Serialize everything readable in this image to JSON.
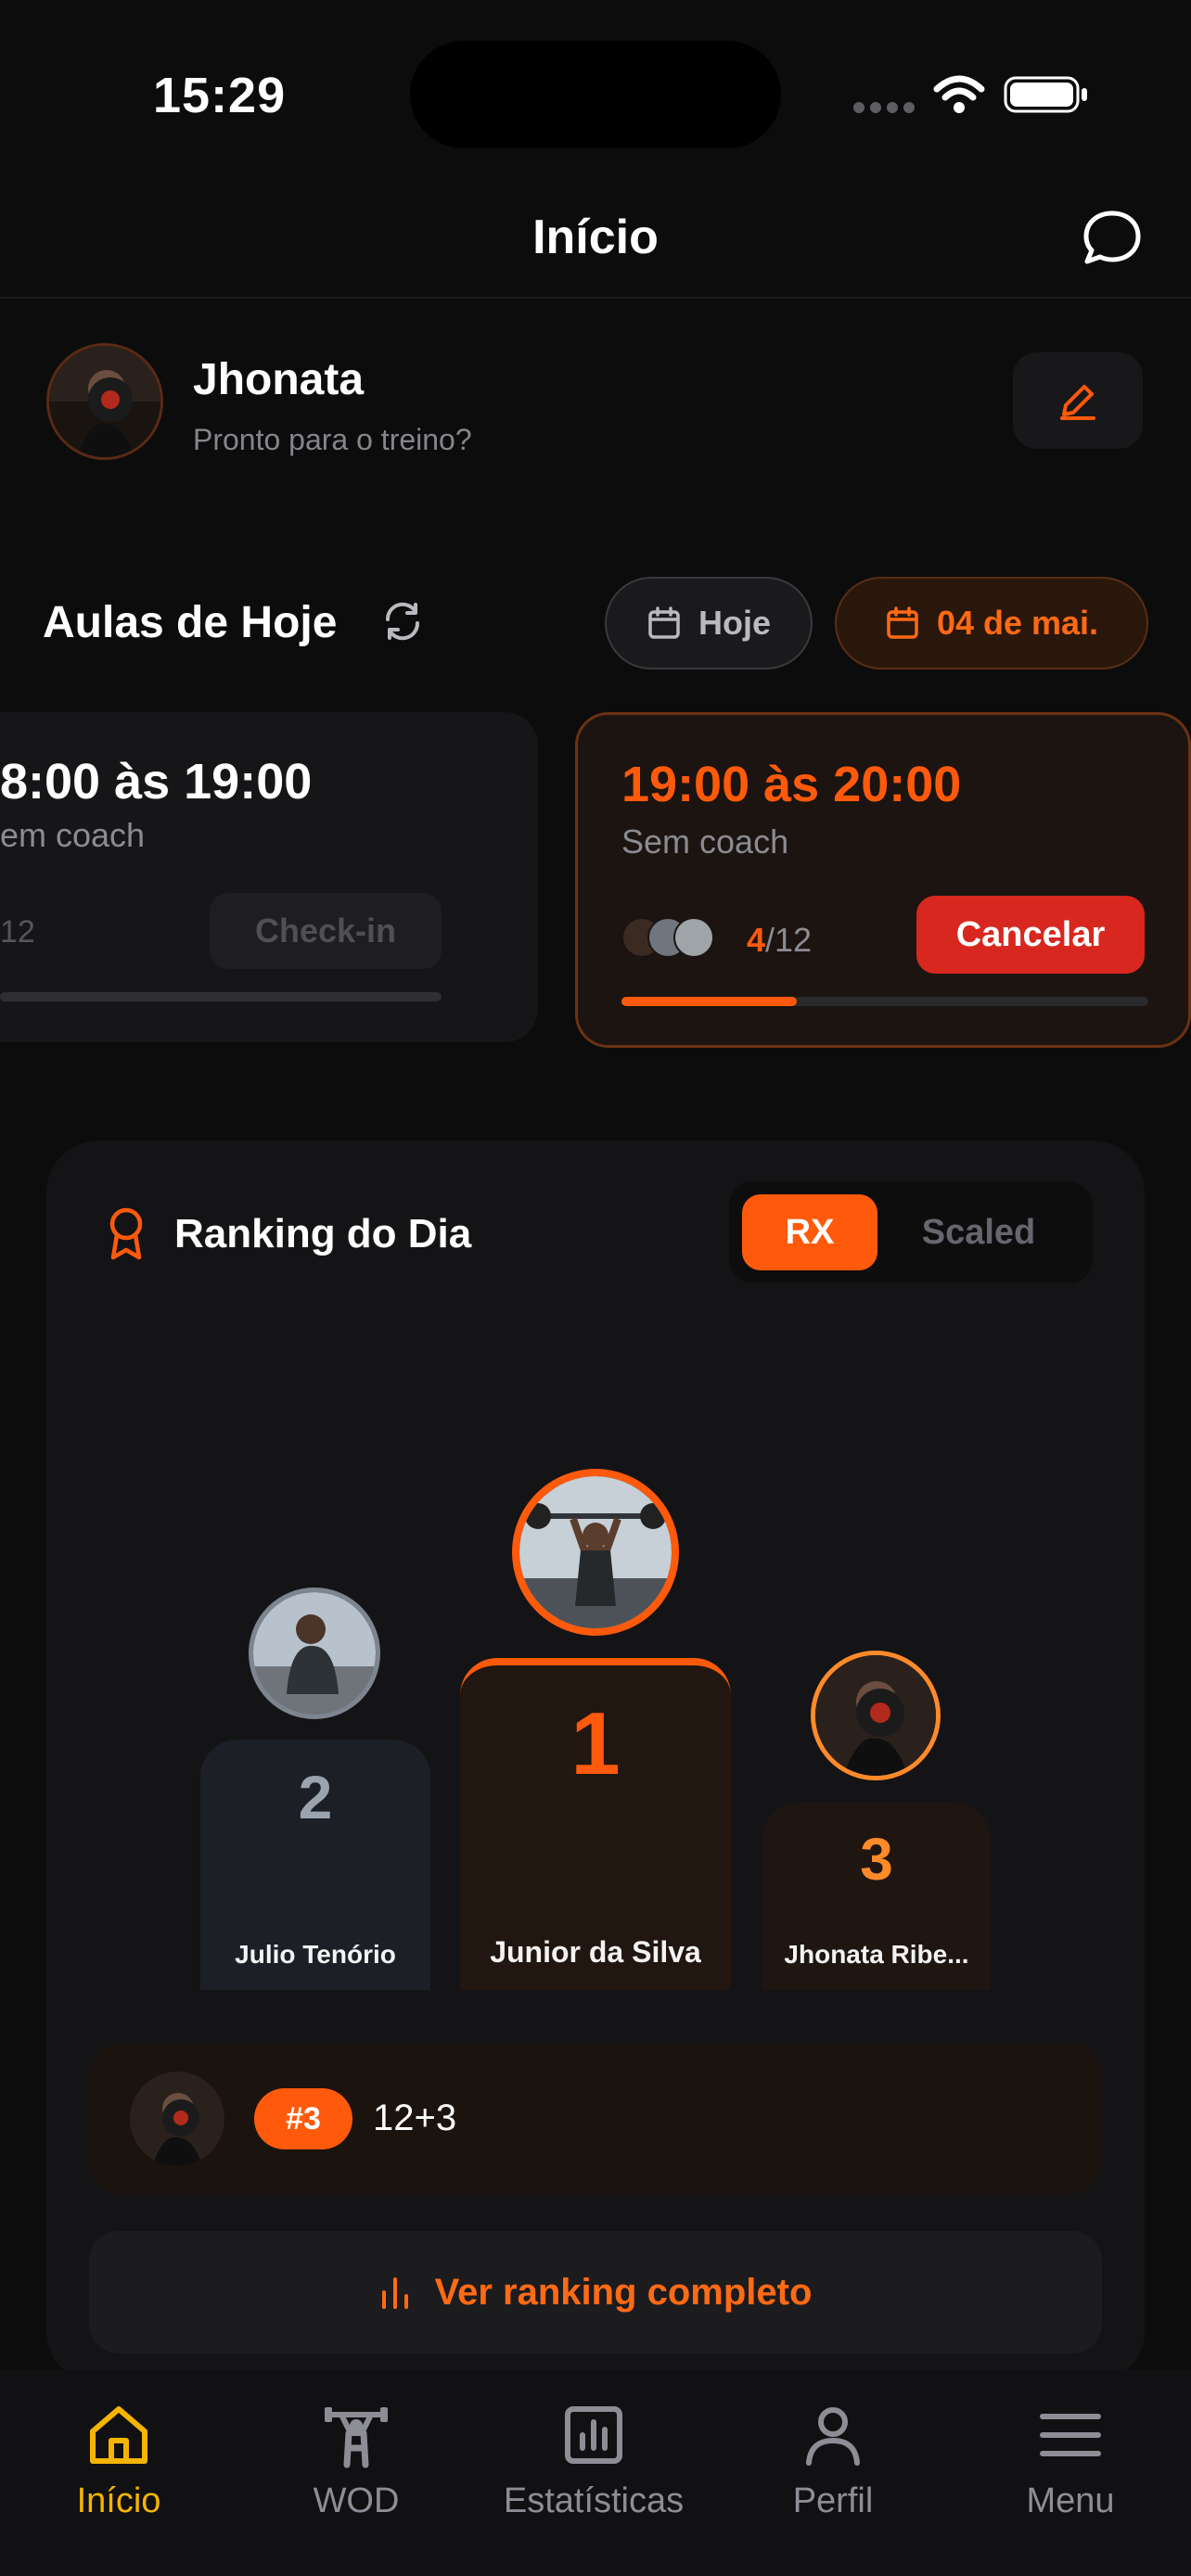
{
  "status_bar": {
    "time": "15:29"
  },
  "header": {
    "title": "Início"
  },
  "profile": {
    "name": "Jhonata",
    "subtitle": "Pronto para o treino?"
  },
  "today": {
    "title": "Aulas de Hoje",
    "chip_today": "Hoje",
    "chip_date": "04 de mai.",
    "classes": [
      {
        "time": "8:00 às 19:00",
        "coach": "em coach",
        "count": "12",
        "button": "Check-in",
        "fill": 1.0
      },
      {
        "time": "19:00 às 20:00",
        "coach": "Sem coach",
        "count_current": "4",
        "count_total": "/12",
        "button": "Cancelar",
        "fill": 0.333
      }
    ]
  },
  "ranking": {
    "title": "Ranking do Dia",
    "tabs": [
      "RX",
      "Scaled"
    ],
    "active_tab": "RX",
    "podium": [
      {
        "place": "2",
        "name": "Julio Tenório"
      },
      {
        "place": "1",
        "name": "Junior da Silva"
      },
      {
        "place": "3",
        "name": "Jhonata Ribe..."
      }
    ],
    "me": {
      "badge": "#3",
      "score": "12+3"
    },
    "see_all": "Ver ranking completo"
  },
  "tabbar": {
    "items": [
      {
        "label": "Início",
        "icon": "home-icon",
        "active": true
      },
      {
        "label": "WOD",
        "icon": "weightlifter-icon",
        "active": false
      },
      {
        "label": "Estatísticas",
        "icon": "chart-icon",
        "active": false
      },
      {
        "label": "Perfil",
        "icon": "person-icon",
        "active": false
      },
      {
        "label": "Menu",
        "icon": "hamburger-icon",
        "active": false
      }
    ]
  },
  "colors": {
    "accent": "#ff5a0c",
    "tab_active": "#f5b400",
    "cancel": "#d8271f",
    "background": "#0c0c0d"
  }
}
